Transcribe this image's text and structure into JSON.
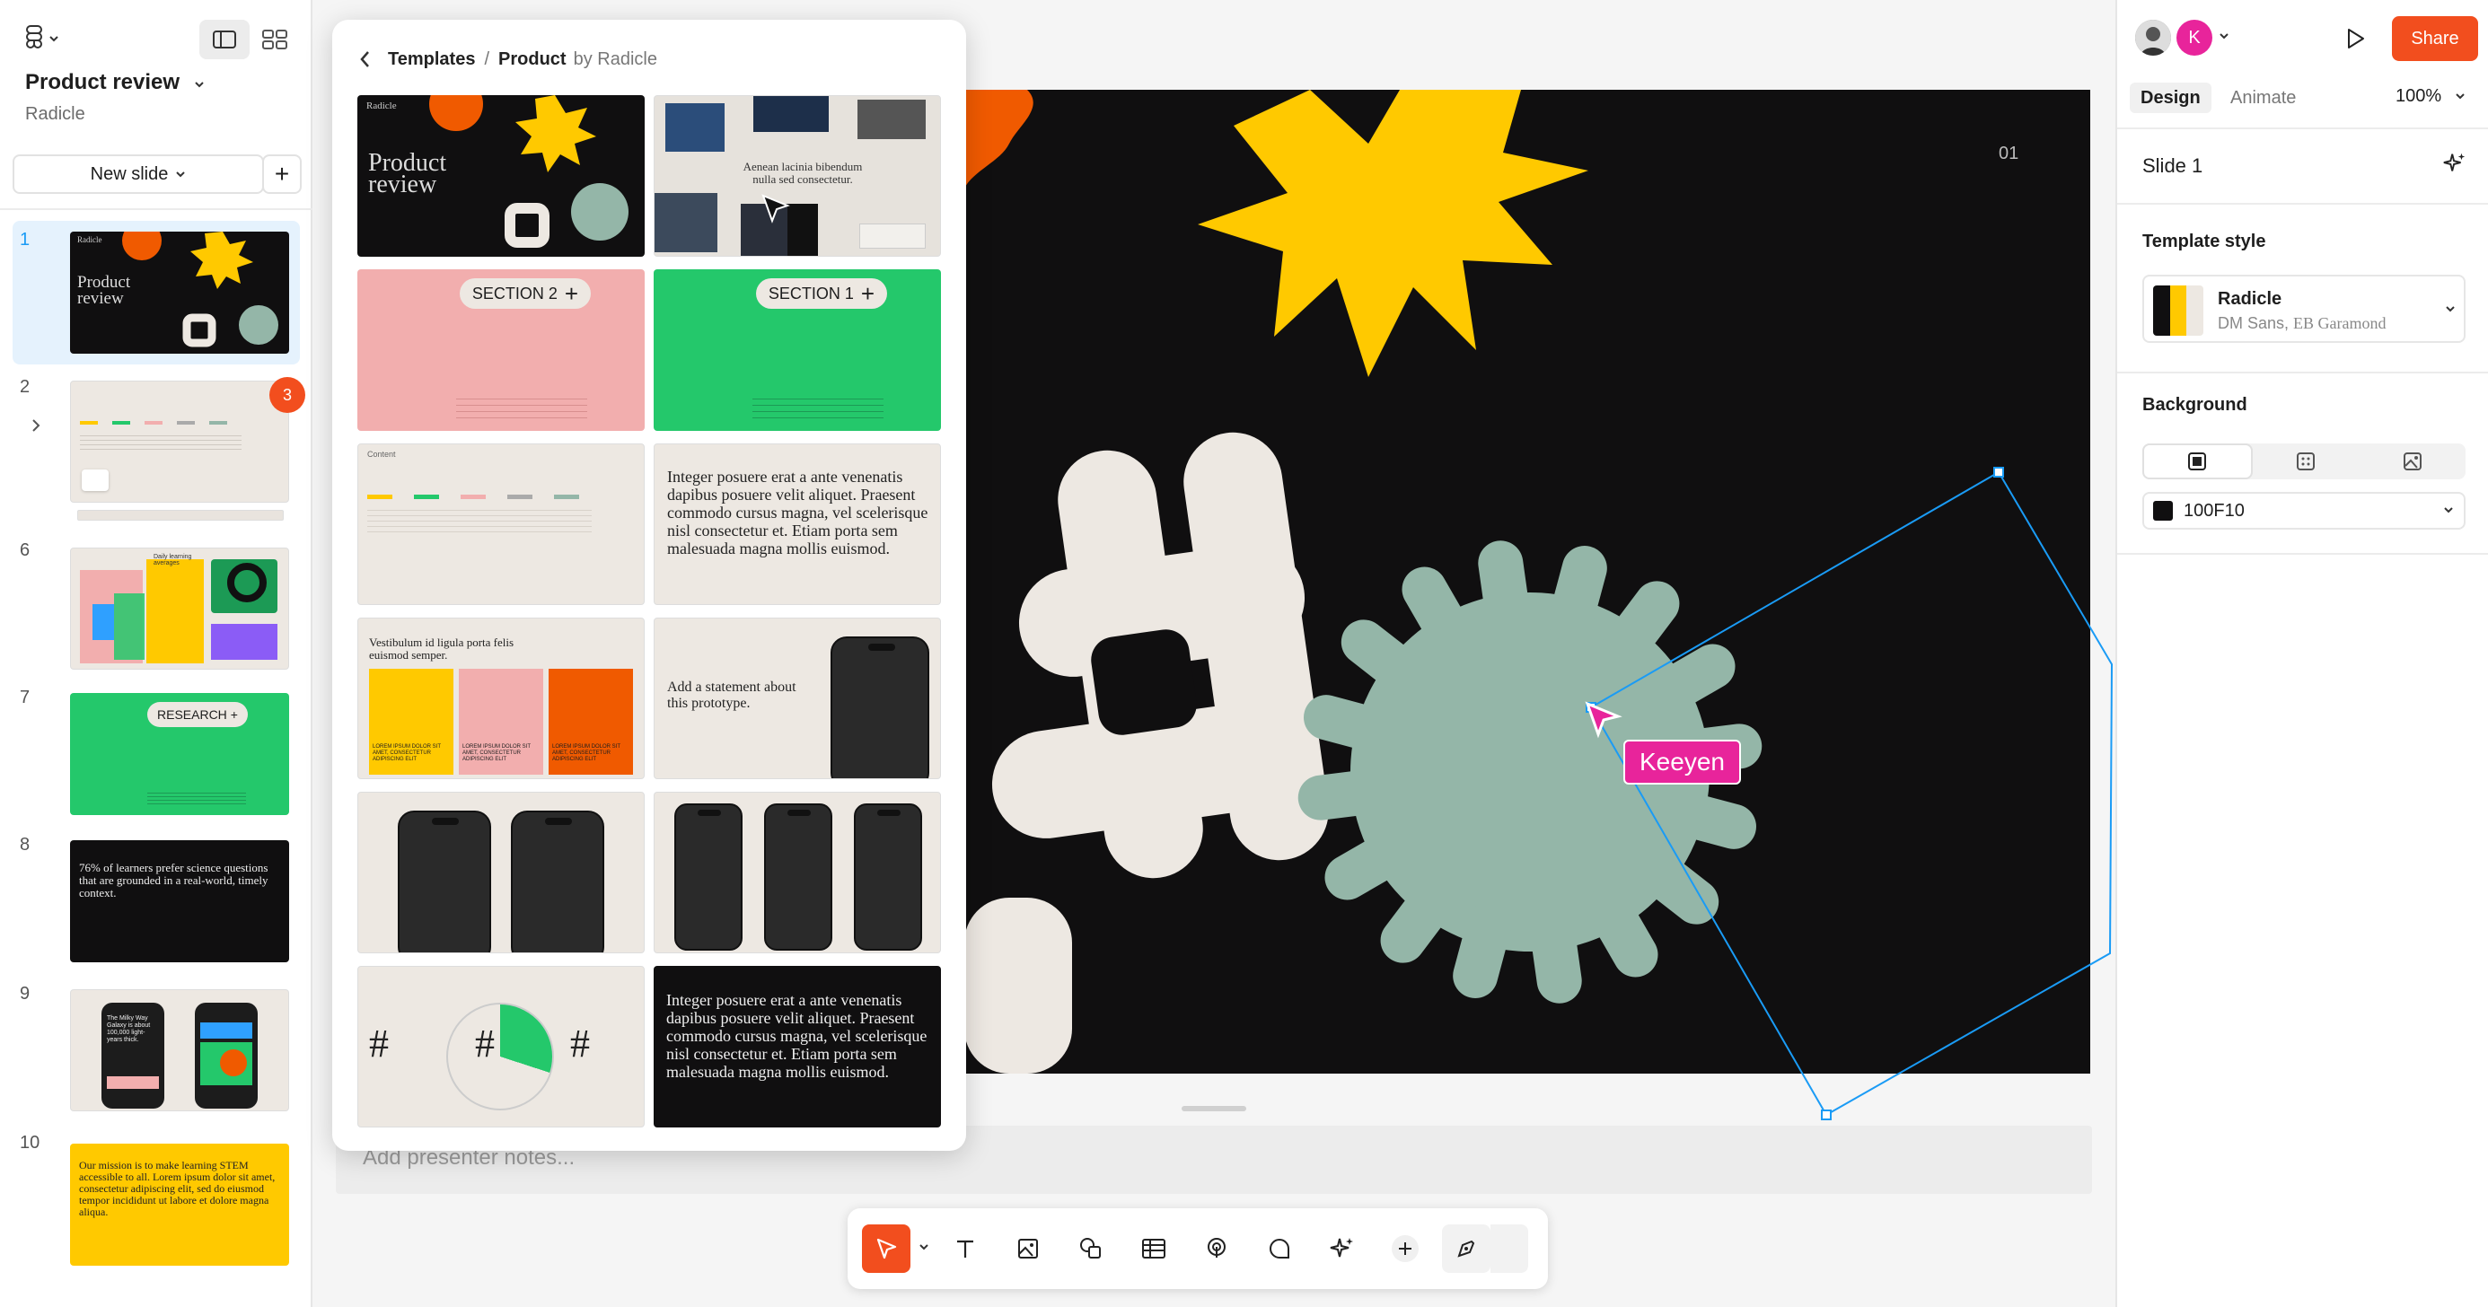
{
  "app": {
    "doc_title": "Product review",
    "doc_subtitle": "Radicle"
  },
  "sidebar": {
    "new_slide_label": "New slide",
    "comment_badge": "3",
    "slides": [
      {
        "num": "1",
        "title": "Product review",
        "brand": "Radicle"
      },
      {
        "num": "2"
      },
      {
        "num": "6",
        "text": "Daily learning averages"
      },
      {
        "num": "7",
        "tag": "RESEARCH"
      },
      {
        "num": "8",
        "text": "76% of learners prefer science questions that are grounded in a real-world, timely context."
      },
      {
        "num": "9",
        "text": "The Milky Way Galaxy is about 100,000 light-years thick."
      },
      {
        "num": "10",
        "text": "Our mission is to make learning STEM accessible to all. Lorem ipsum dolor sit amet, consectetur adipiscing elit, sed do eiusmod tempor incididunt ut labore et dolore magna aliqua."
      }
    ]
  },
  "templates": {
    "breadcrumb_root": "Templates",
    "breadcrumb_sep": "/",
    "breadcrumb_current": "Product",
    "breadcrumb_by": "by Radicle",
    "cards": [
      {
        "title": "Product review",
        "brand": "Radicle"
      },
      {
        "text": "Aenean lacinia bibendum nulla sed consectetur."
      },
      {
        "tag": "SECTION 2"
      },
      {
        "tag": "SECTION 1"
      },
      {
        "label": "Content"
      },
      {
        "text": "Integer posuere erat a ante venenatis dapibus posuere velit aliquet. Praesent commodo cursus magna, vel scelerisque nisl consectetur et. Etiam porta sem malesuada magna mollis euismod."
      },
      {
        "text": "Vestibulum id ligula porta felis euismod semper.",
        "col1": "LOREM IPSUM DOLOR SIT AMET, CONSECTETUR ADIPISCING ELIT",
        "col2": "LOREM IPSUM DOLOR SIT AMET, CONSECTETUR ADIPISCING ELIT",
        "col3": "LOREM IPSUM DOLOR SIT AMET, CONSECTETUR ADIPISCING ELIT"
      },
      {
        "text": "Add a statement about this prototype."
      },
      {},
      {},
      {
        "hash": "#"
      },
      {
        "text": "Integer posuere erat a ante venenatis dapibus posuere velit aliquet. Praesent commodo cursus magna, vel scelerisque nisl consectetur et. Etiam porta sem malesuada magna mollis euismod."
      }
    ]
  },
  "canvas": {
    "slide_number": "01",
    "cursor_user": "Keeyen",
    "notes_placeholder": "Add presenter notes..."
  },
  "toolbar": {
    "tools": [
      "move-tool",
      "text-tool",
      "image-tool",
      "shape-tool",
      "table-tool",
      "interaction-tool",
      "comment-tool",
      "ai-tool",
      "add-tool",
      "draw-tool"
    ]
  },
  "right_panel": {
    "avatar_letter": "K",
    "share_label": "Share",
    "tab_design": "Design",
    "tab_animate": "Animate",
    "zoom": "100%",
    "selection_title": "Slide 1",
    "template_style_label": "Template style",
    "style_name": "Radicle",
    "style_fonts_sans": "DM Sans,",
    "style_fonts_serif": "EB Garamond",
    "background_label": "Background",
    "bg_color": "100F10"
  },
  "colors": {
    "accent": "#f24e1e",
    "selection": "#1a9bf5",
    "cursor": "#e8249b",
    "yellow": "#ffc900",
    "orange": "#f05a00",
    "sage": "#94b6a8",
    "cream": "#ede8e2",
    "green": "#24c86b",
    "pink": "#f2aeae"
  }
}
